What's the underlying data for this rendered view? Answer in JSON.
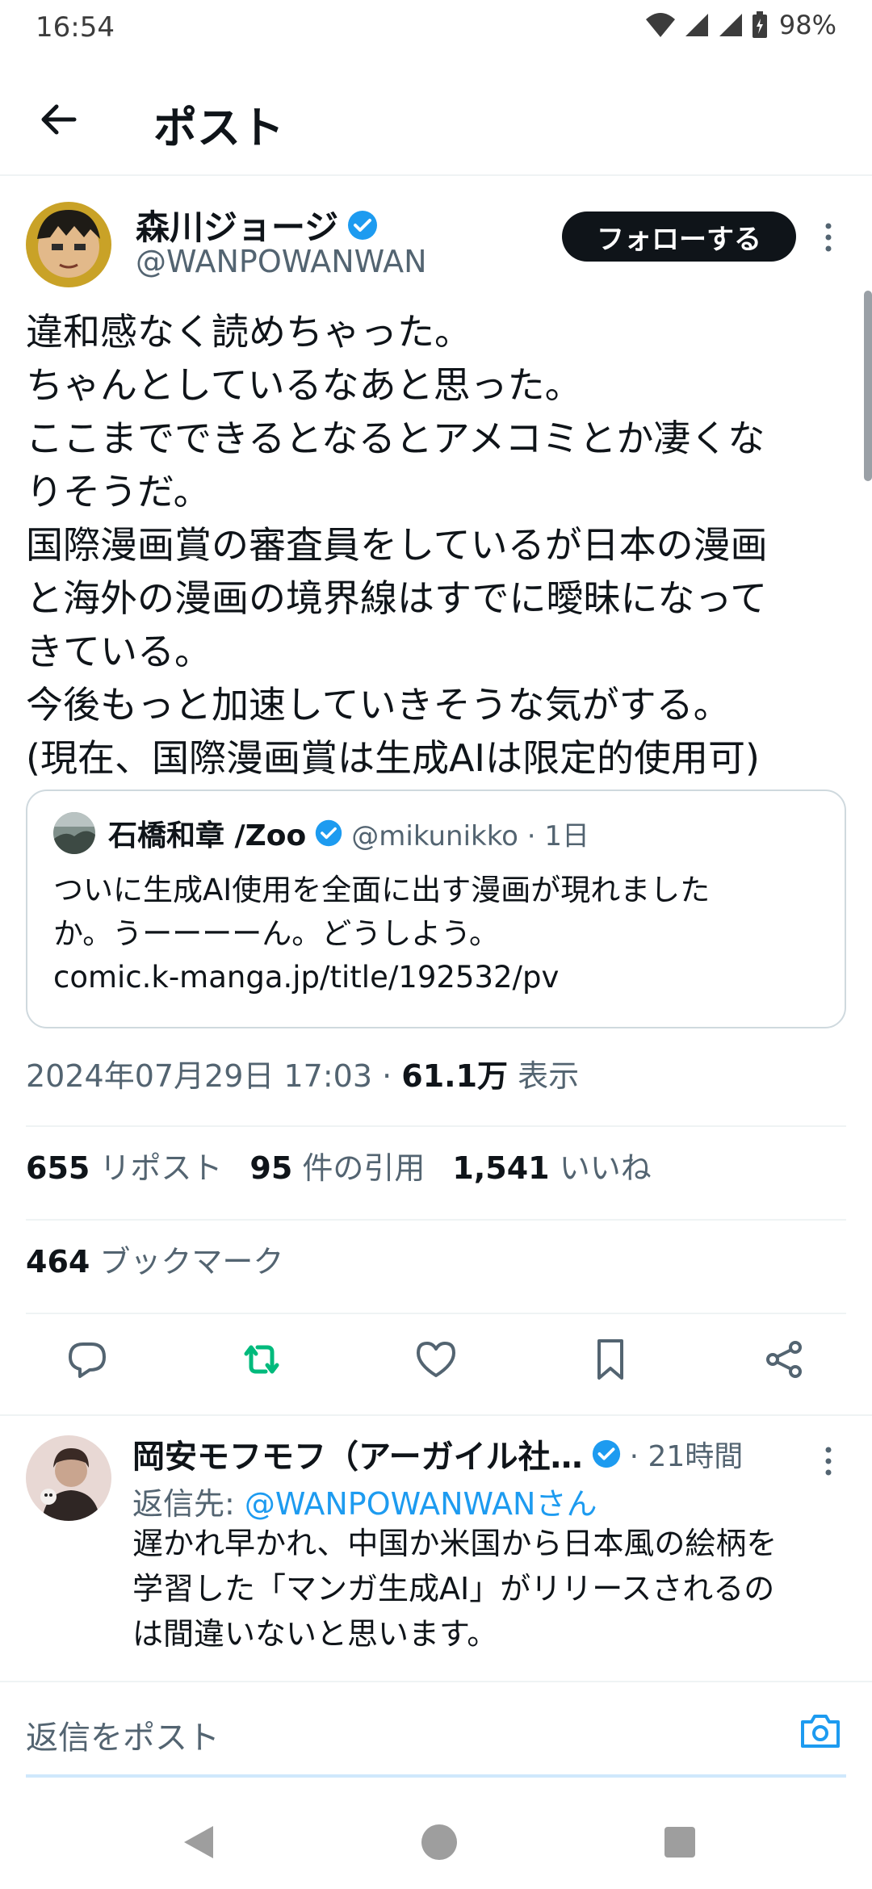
{
  "status_bar": {
    "time": "16:54",
    "battery": "98%"
  },
  "header": {
    "title": "ポスト"
  },
  "post": {
    "author_name": "森川ジョージ",
    "author_handle": "@WANPOWANWAN",
    "follow_label": "フォローする",
    "text_lines": [
      "違和感なく読めちゃった。",
      "ちゃんとしているなあと思った。",
      "ここまでできるとなるとアメコミとか凄くな",
      "りそうだ。",
      "国際漫画賞の審査員をしているが日本の漫画",
      "と海外の漫画の境界線はすでに曖昧になって",
      "きている。",
      "今後もっと加速していきそうな気がする。",
      "(現在、国際漫画賞は生成AIは限定的使用可)"
    ],
    "quote": {
      "author_name": "石橋和章 /Zoo",
      "author_handle": "@mikunikko · 1日",
      "text_lines": [
        "ついに生成AI使用を全面に出す漫画が現れました",
        "か。うーーーーん。どうしよう。",
        "comic.k-manga.jp/title/192532/pv"
      ]
    },
    "timestamp": "2024年07月29日 17:03 · ",
    "views_count": "61.1万",
    "views_label": " 表示",
    "stats": {
      "reposts_count": "655",
      "reposts_label": " リポスト",
      "quotes_count": "95",
      "quotes_label": " 件の引用",
      "likes_count": "1,541",
      "likes_label": " いいね",
      "bookmarks_count": "464",
      "bookmarks_label": " ブックマーク"
    }
  },
  "reply": {
    "author_name": "岡安モフモフ（アーガイル社…",
    "time": "· 21時間",
    "reply_to_prefix": "返信先: ",
    "reply_to_mention": "@WANPOWANWANさん",
    "text_lines": [
      "遅かれ早かれ、中国か米国から日本風の絵柄を",
      "学習した「マンガ生成AI」がリリースされるの",
      "は間違いないと思います。"
    ]
  },
  "composer": {
    "placeholder": "返信をポスト"
  },
  "colors": {
    "verified_blue": "#1d9bf0",
    "repost_green": "#00ba7c",
    "text_primary": "#0f1419",
    "text_secondary": "#536471"
  },
  "icons": [
    "back-arrow-icon",
    "verified-badge-icon",
    "more-icon",
    "reply-icon",
    "repost-icon",
    "like-icon",
    "bookmark-icon",
    "share-icon",
    "camera-icon",
    "wifi-icon",
    "signal-icon",
    "battery-icon"
  ]
}
